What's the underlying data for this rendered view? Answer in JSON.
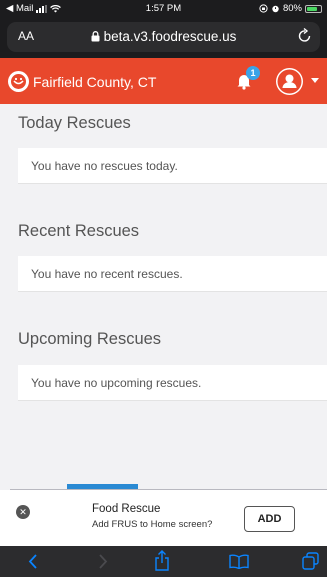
{
  "status_bar": {
    "back_app": "◀ Mail",
    "time": "1:57 PM",
    "battery": "80%",
    "wifi_icon": "wifi-icon",
    "signal_icon": "signal-bars-icon",
    "battery_color": "#4cd964"
  },
  "browser": {
    "reader_label": "AA",
    "url": "beta.v3.foodrescue.us",
    "lock_icon": "lock-icon",
    "reload_icon": "reload-icon"
  },
  "header": {
    "region": "Fairfield County, CT",
    "notification_count": "1",
    "brand_color": "#e8482c",
    "badge_color": "#3aa3e8"
  },
  "sections": [
    {
      "title": "Today Rescues",
      "message": "You have no rescues today."
    },
    {
      "title": "Recent Rescues",
      "message": "You have no recent rescues."
    },
    {
      "title": "Upcoming Rescues",
      "message": "You have no upcoming rescues."
    }
  ],
  "install_banner": {
    "app_name": "Food Rescue",
    "prompt": "Add FRUS to Home screen?",
    "add_label": "ADD",
    "close_icon": "close-icon"
  },
  "toolbar": {
    "icons": [
      "back-icon",
      "forward-icon",
      "share-icon",
      "bookmarks-icon",
      "tabs-icon"
    ],
    "accent_color": "#0a84ff"
  }
}
